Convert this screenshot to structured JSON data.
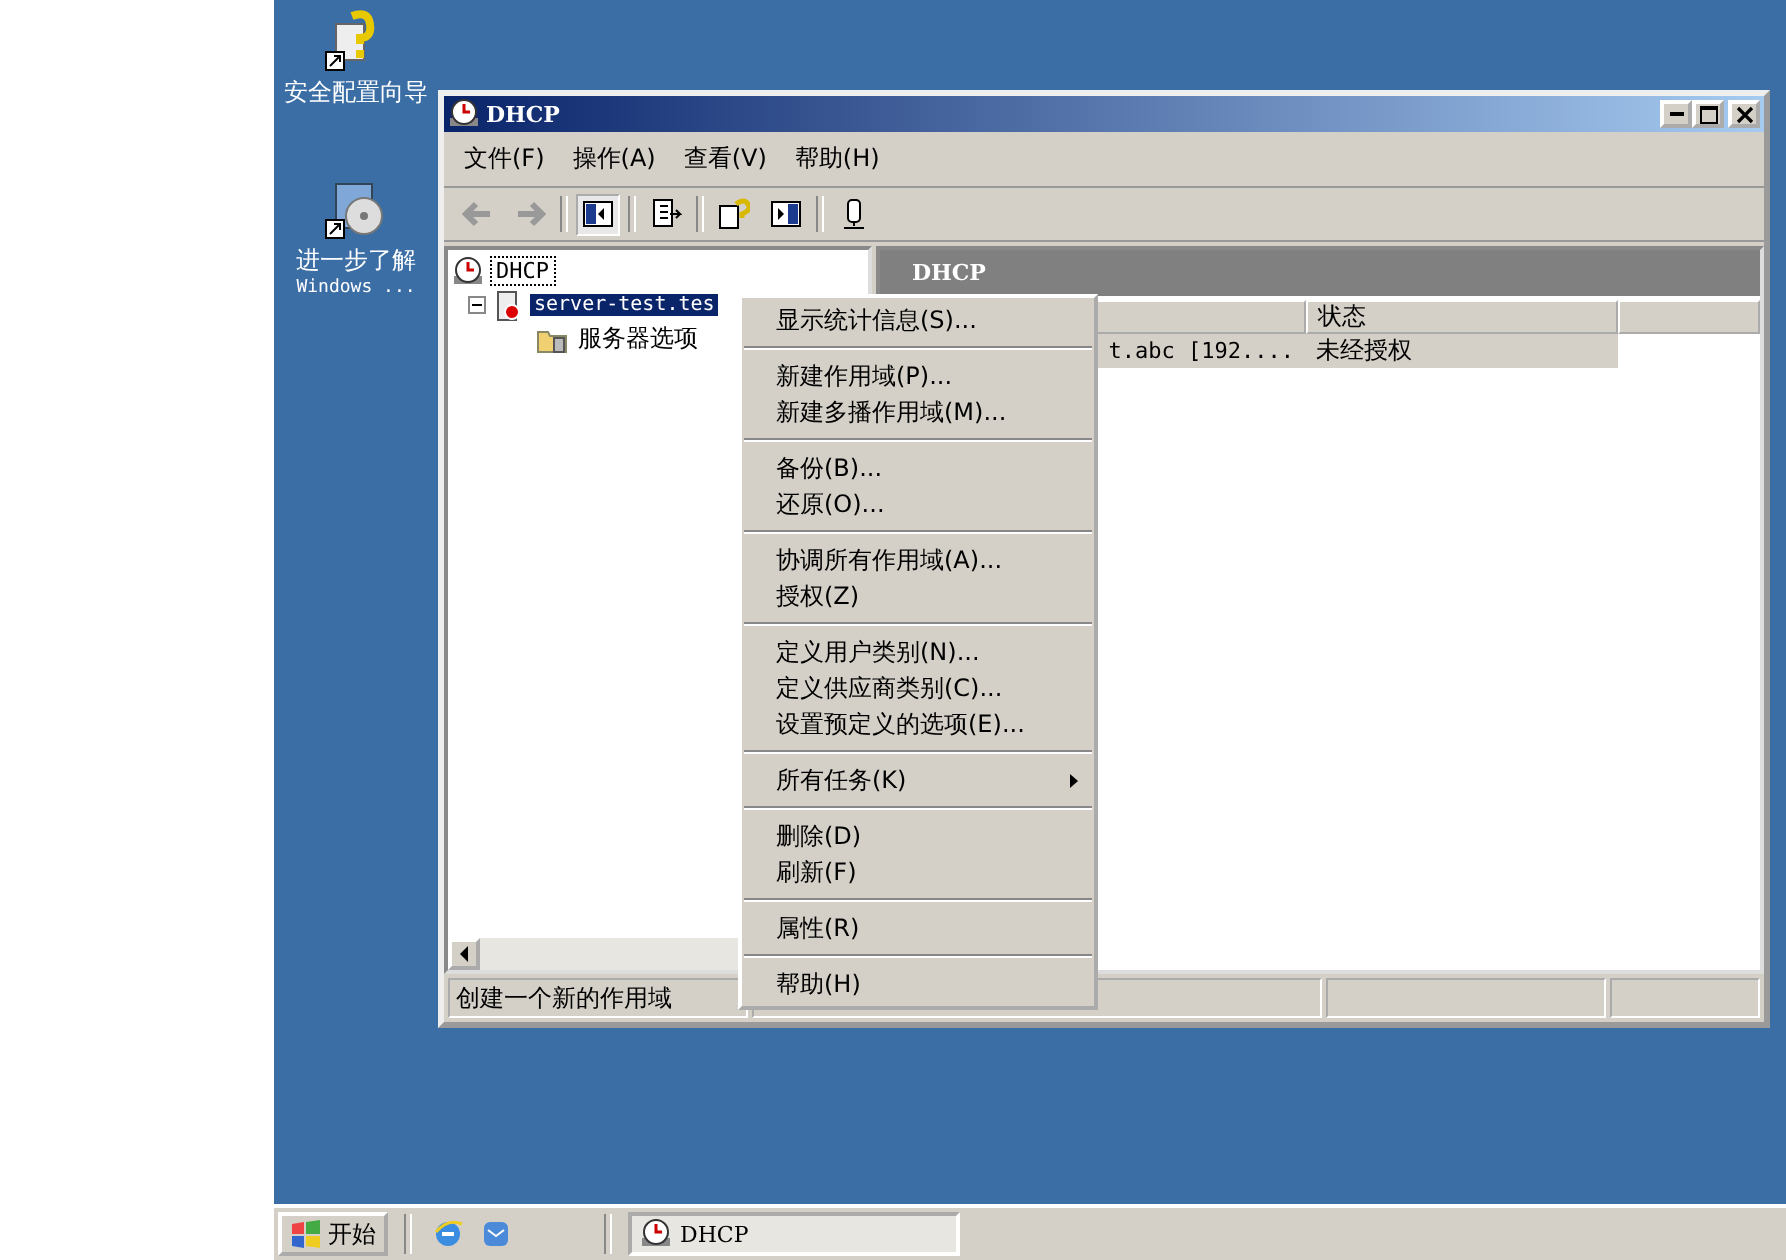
{
  "desktop_icons": [
    {
      "label": "安全配置向导",
      "kind": "wizard"
    },
    {
      "label": "进一步了解",
      "sublabel": "Windows ...",
      "kind": "disc"
    }
  ],
  "window": {
    "title": "DHCP",
    "menu_bar": [
      "文件(F)",
      "操作(A)",
      "查看(V)",
      "帮助(H)"
    ],
    "tree": {
      "label": "DHCP",
      "children": [
        {
          "label": "server-test.tes",
          "selected": true,
          "expanded": true,
          "children": [
            {
              "label": "服务器选项"
            }
          ]
        }
      ]
    },
    "details": {
      "header": "DHCP",
      "columns": [
        "",
        "状态"
      ],
      "rows": [
        {
          "cells": [
            "t.abc [192....",
            "未经授权"
          ]
        }
      ]
    },
    "status_bar": [
      "创建一个新的作用域"
    ]
  },
  "context_menu": {
    "groups": [
      [
        {
          "label": "显示统计信息(S)..."
        }
      ],
      [
        {
          "label": "新建作用域(P)..."
        },
        {
          "label": "新建多播作用域(M)..."
        }
      ],
      [
        {
          "label": "备份(B)..."
        },
        {
          "label": "还原(O)..."
        }
      ],
      [
        {
          "label": "协调所有作用域(A)..."
        },
        {
          "label": "授权(Z)"
        }
      ],
      [
        {
          "label": "定义用户类别(N)..."
        },
        {
          "label": "定义供应商类别(C)..."
        },
        {
          "label": "设置预定义的选项(E)..."
        }
      ],
      [
        {
          "label": "所有任务(K)",
          "has_submenu": true
        }
      ],
      [
        {
          "label": "删除(D)"
        },
        {
          "label": "刷新(F)"
        }
      ],
      [
        {
          "label": "属性(R)"
        }
      ],
      [
        {
          "label": "帮助(H)"
        }
      ]
    ]
  },
  "taskbar": {
    "start": "开始",
    "tasks": [
      {
        "label": "DHCP",
        "selected": true
      }
    ]
  }
}
